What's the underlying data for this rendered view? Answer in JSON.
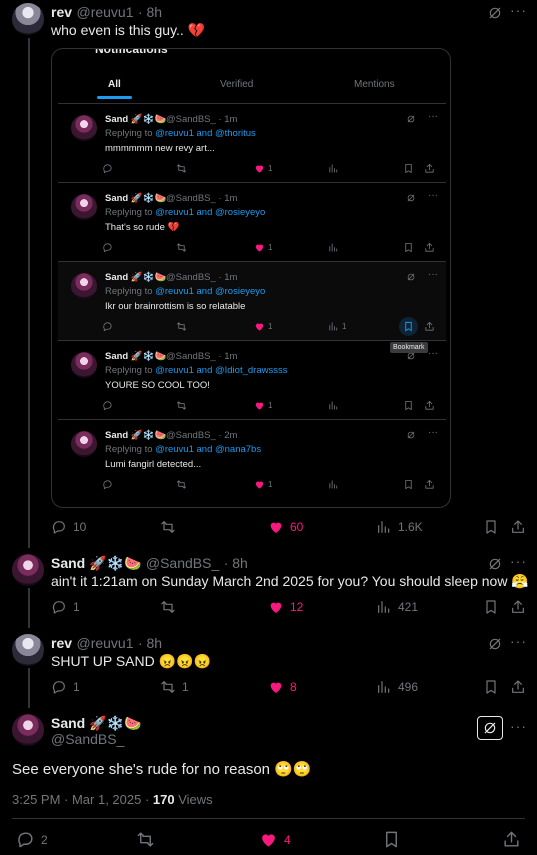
{
  "tweets": [
    {
      "name": "rev",
      "handle": "@reuvu1",
      "time": "· 8h",
      "text": "who even is this guy.. 💔",
      "replies": "10",
      "retweets": "",
      "likes": "60",
      "views": "1.6K"
    },
    {
      "name": "Sand 🚀❄️🍉",
      "handle": "@SandBS_",
      "time": "· 8h",
      "text": "ain't it 1:21am on Sunday March 2nd 2025 for you? You should sleep now 😤",
      "replies": "1",
      "retweets": "",
      "likes": "12",
      "views": "421"
    },
    {
      "name": "rev",
      "handle": "@reuvu1",
      "time": "· 8h",
      "text": "SHUT UP SAND 😠😠😠",
      "replies": "1",
      "retweets": "1",
      "likes": "8",
      "views": "496"
    }
  ],
  "main_tweet": {
    "name": "Sand 🚀❄️🍉",
    "handle": "@SandBS_",
    "text": "See everyone she's rude for no reason 🙄🙄",
    "timestamp": "3:25 PM · Mar 1, 2025 · ",
    "views_count": "170",
    "views_label": " Views",
    "replies": "2",
    "likes": "4"
  },
  "embedded": {
    "header_title": "Notifications",
    "tabs": [
      "All",
      "Verified",
      "Mentions"
    ],
    "rows": [
      {
        "name": "Sand 🚀❄️🍉",
        "handle": "@SandBS_ · 1m",
        "replying_prefix": "Replying to ",
        "replying": "@reuvu1 and @thoritus",
        "text": "mmmmmm new revy art...",
        "likes": "1",
        "views": ""
      },
      {
        "name": "Sand 🚀❄️🍉",
        "handle": "@SandBS_ · 1m",
        "replying_prefix": "Replying to ",
        "replying": "@reuvu1 and @rosieyeyo",
        "text": "That's so rude 💔",
        "likes": "1",
        "views": ""
      },
      {
        "name": "Sand 🚀❄️🍉",
        "handle": "@SandBS_ · 1m",
        "replying_prefix": "Replying to ",
        "replying": "@reuvu1 and @rosieyeyo",
        "text": "Ikr our brainrottism is so relatable",
        "likes": "1",
        "views": "1"
      },
      {
        "name": "Sand 🚀❄️🍉",
        "handle": "@SandBS_ · 1m",
        "replying_prefix": "Replying to ",
        "replying": "@reuvu1 and @Idiot_drawssss",
        "text": "YOURE SO COOL TOO!",
        "likes": "1",
        "views": ""
      },
      {
        "name": "Sand 🚀❄️🍉",
        "handle": "@SandBS_ · 2m",
        "replying_prefix": "Replying to ",
        "replying": "@reuvu1 and @nana7bs",
        "text": "Lumi fangirl detected...",
        "likes": "1",
        "views": ""
      }
    ],
    "tooltip": "Bookmark"
  },
  "colors": {
    "accent": "#1d9bf0",
    "like": "#f91880",
    "muted": "#71767b",
    "border": "#2f3336"
  },
  "icons": [
    "reply-icon",
    "retweet-icon",
    "heart-icon",
    "views-icon",
    "bookmark-icon",
    "share-icon",
    "grok-icon",
    "more-icon"
  ]
}
